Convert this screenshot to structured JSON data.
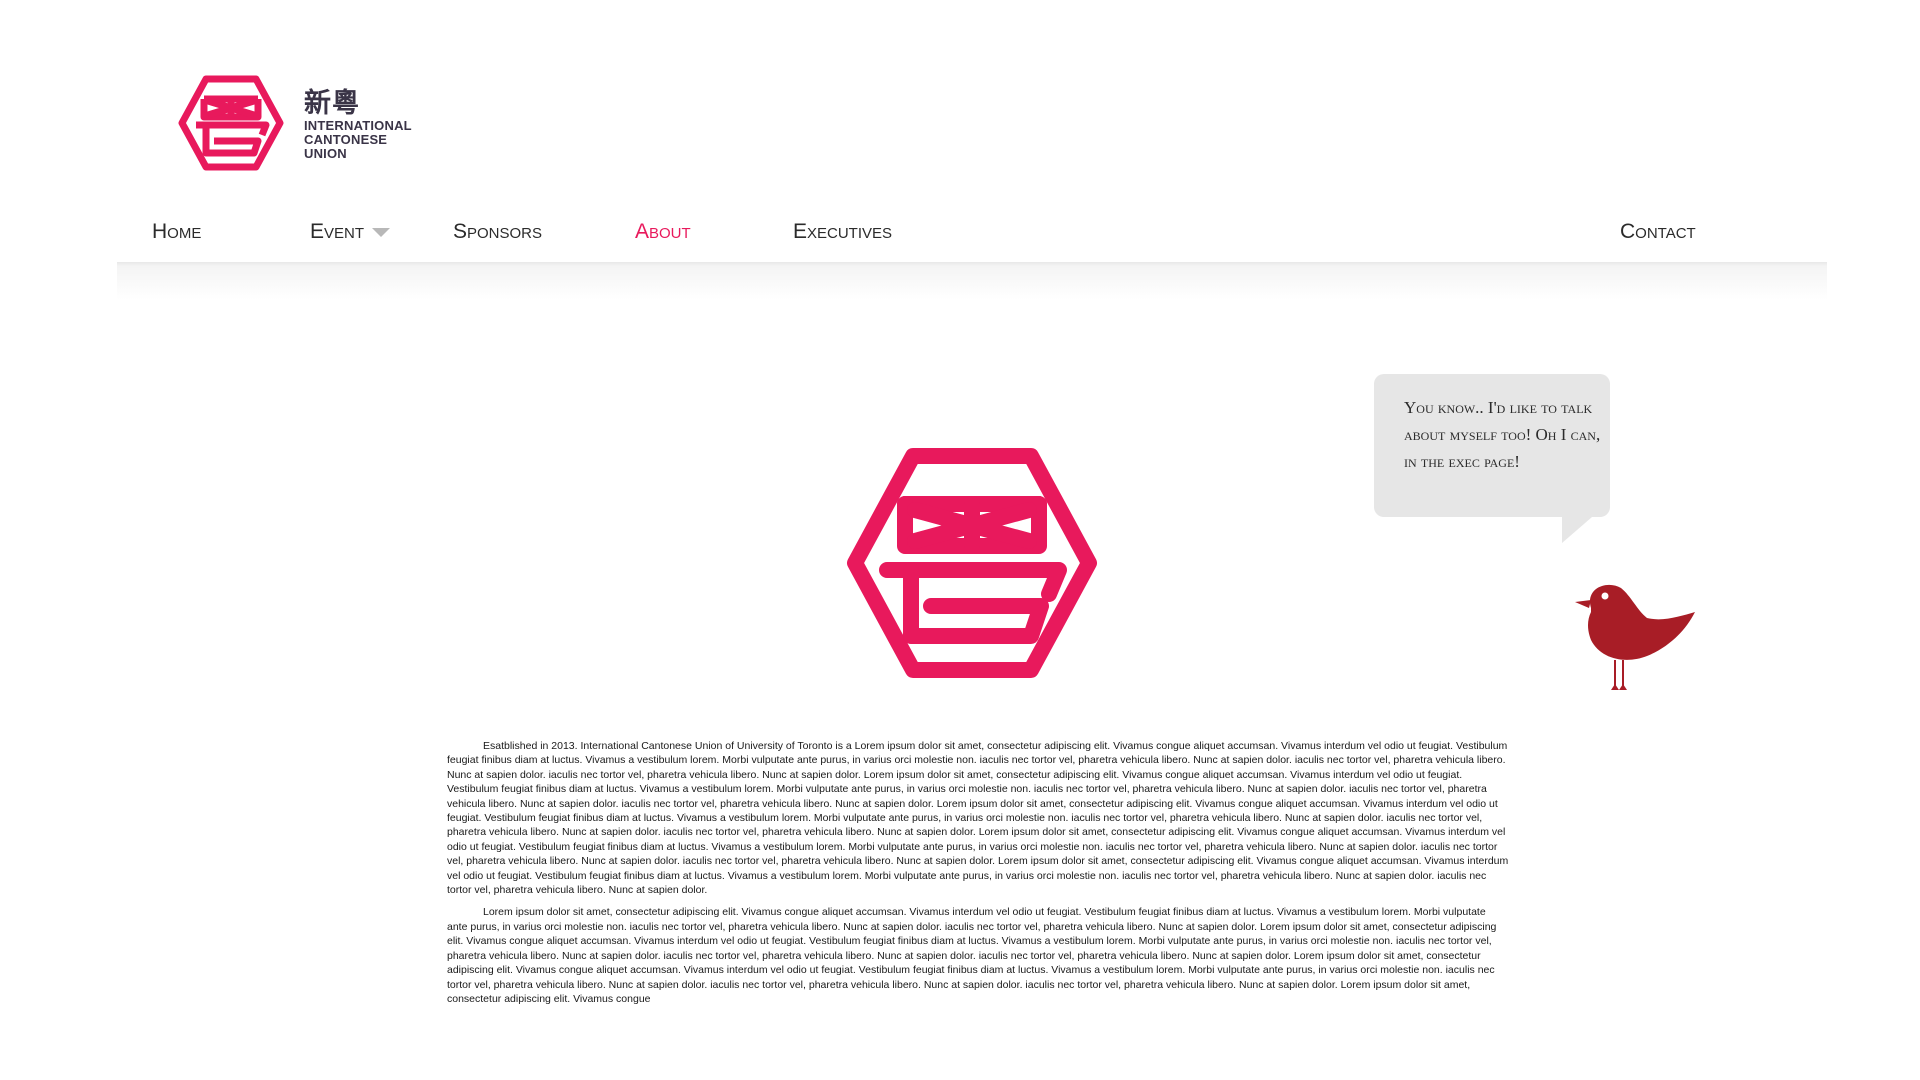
{
  "brand": {
    "chinese": "新粵",
    "line1": "INTERNATIONAL",
    "line2": "CANTONESE",
    "line3": "UNION",
    "accent_color": "#e8195c"
  },
  "nav": {
    "home": "Home",
    "event": "Event",
    "sponsors": "Sponsors",
    "about": "About",
    "executives": "Executives",
    "contact": "Contact",
    "active": "About"
  },
  "bubble": {
    "text": "You know.. I'd like to talk about myself too! Oh I can, in the exec page!"
  },
  "bird": {
    "icon": "bird-icon",
    "color": "#a81d26"
  },
  "about": {
    "paragraph1": "Esatblished in 2013. International Cantonese Union of University of Toronto is a Lorem ipsum dolor sit amet, consectetur adipiscing elit. Vivamus congue aliquet accumsan. Vivamus interdum vel odio ut feugiat. Vestibulum feugiat finibus diam at luctus. Vivamus a vestibulum lorem. Morbi vulputate ante purus, in varius orci molestie non. iaculis nec tortor vel, pharetra vehicula libero. Nunc at sapien dolor.  iaculis nec tortor vel, pharetra vehicula libero. Nunc at sapien dolor.  iaculis nec tortor vel, pharetra vehicula libero. Nunc at sapien dolor. Lorem ipsum dolor sit amet, consectetur adipiscing elit. Vivamus congue aliquet accumsan. Vivamus interdum vel odio ut feugiat. Vestibulum feugiat finibus diam at luctus. Vivamus a vestibulum lorem. Morbi vulputate ante purus, in varius orci molestie non. iaculis nec tortor vel, pharetra vehicula libero. Nunc at sapien dolor.  iaculis nec tortor vel, pharetra vehicula libero. Nunc at sapien dolor.  iaculis nec tortor vel, pharetra vehicula libero. Nunc at sapien dolor. Lorem ipsum dolor sit amet, consectetur adipiscing elit. Vivamus congue aliquet accumsan. Vivamus interdum vel odio ut feugiat. Vestibulum feugiat finibus diam at luctus. Vivamus a vestibulum lorem. Morbi vulputate ante purus, in varius orci molestie non. iaculis nec tortor vel, pharetra vehicula libero. Nunc at sapien dolor.  iaculis nec tortor vel, pharetra vehicula libero. Nunc at sapien dolor.  iaculis nec tortor vel, pharetra vehicula libero. Nunc at sapien dolor. Lorem ipsum dolor sit amet, consectetur adipiscing elit. Vivamus congue aliquet accumsan. Vivamus interdum vel odio ut feugiat. Vestibulum feugiat finibus diam at luctus. Vivamus a vestibulum lorem. Morbi vulputate ante purus, in varius orci molestie non. iaculis nec tortor vel, pharetra vehicula libero. Nunc at sapien dolor.  iaculis nec tortor vel, pharetra vehicula libero. Nunc at sapien dolor.  iaculis nec tortor vel, pharetra vehicula libero. Nunc at sapien dolor. Lorem ipsum dolor sit amet, consectetur adipiscing elit. Vivamus congue aliquet accumsan. Vivamus interdum vel odio ut feugiat. Vestibulum feugiat finibus diam at luctus. Vivamus a vestibulum lorem. Morbi vulputate ante purus, in varius orci molestie non. iaculis nec tortor vel, pharetra vehicula libero. Nunc at sapien dolor.  iaculis nec tortor vel, pharetra vehicula libero. Nunc at sapien dolor.",
    "paragraph2": "Lorem ipsum dolor sit amet, consectetur adipiscing elit. Vivamus congue aliquet accumsan. Vivamus interdum vel odio ut feugiat. Vestibulum feugiat finibus diam at luctus. Vivamus a vestibulum lorem. Morbi vulputate ante purus, in varius orci molestie non. iaculis nec tortor vel, pharetra vehicula libero. Nunc at sapien dolor.  iaculis nec tortor vel, pharetra vehicula libero. Nunc at sapien dolor. Lorem ipsum dolor sit amet, consectetur adipiscing elit. Vivamus congue aliquet accumsan. Vivamus interdum vel odio ut feugiat. Vestibulum feugiat finibus diam at luctus. Vivamus a vestibulum lorem. Morbi vulputate ante purus, in varius orci molestie non. iaculis nec tortor vel, pharetra vehicula libero. Nunc at sapien dolor.  iaculis nec tortor vel, pharetra vehicula libero. Nunc at sapien dolor.  iaculis nec tortor vel, pharetra vehicula libero. Nunc at sapien dolor. Lorem ipsum dolor sit amet, consectetur adipiscing elit. Vivamus congue aliquet accumsan. Vivamus interdum vel odio ut feugiat. Vestibulum feugiat finibus diam at luctus. Vivamus a vestibulum lorem. Morbi vulputate ante purus, in varius orci molestie non. iaculis nec tortor vel, pharetra vehicula libero. Nunc at sapien dolor.  iaculis nec tortor vel, pharetra vehicula libero. Nunc at sapien dolor.  iaculis nec tortor vel, pharetra vehicula libero. Nunc at sapien dolor. Lorem ipsum dolor sit amet, consectetur adipiscing elit. Vivamus congue"
  }
}
